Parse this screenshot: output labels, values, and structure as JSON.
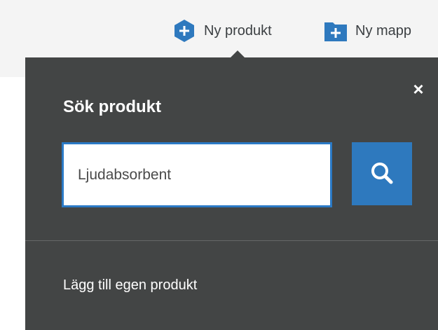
{
  "toolbar": {
    "new_product_label": "Ny produkt",
    "new_folder_label": "Ny mapp",
    "new_product_icon": "hexagon-plus-icon",
    "new_folder_icon": "folder-plus-icon",
    "accent_color": "#2e79be"
  },
  "popover": {
    "title": "Sök produkt",
    "close_label": "×",
    "search": {
      "value": "Ljudabsorbent",
      "button_icon": "search-icon"
    },
    "add_own_label": "Lägg till egen produkt",
    "background_color": "#434545"
  }
}
